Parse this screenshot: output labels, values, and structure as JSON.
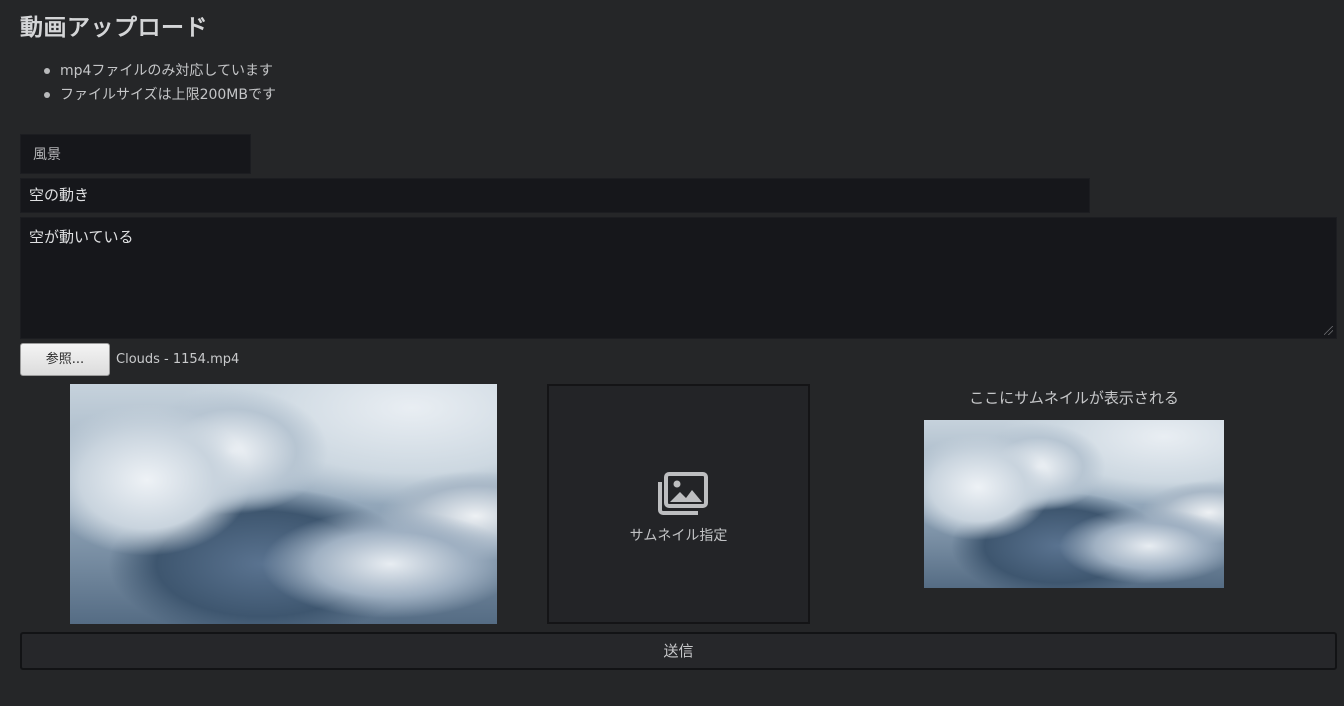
{
  "page": {
    "title": "動画アップロード",
    "notes": [
      "mp4ファイルのみ対応しています",
      "ファイルサイズは上限200MBです"
    ]
  },
  "form": {
    "category": "風景",
    "video_title": "空の動き",
    "description": "空が動いている",
    "browse_label": "参照...",
    "file_name": "Clouds - 1154.mp4",
    "thumbnail_button_label": "サムネイル指定",
    "thumbnail_caption": "ここにサムネイルが表示される",
    "submit_label": "送信"
  },
  "icons": {
    "thumbnail_button": "gallery-icon",
    "bullet": "bullet-icon"
  },
  "colors": {
    "background": "#252628",
    "field_background": "#16171b",
    "text": "#cfd0d2"
  }
}
